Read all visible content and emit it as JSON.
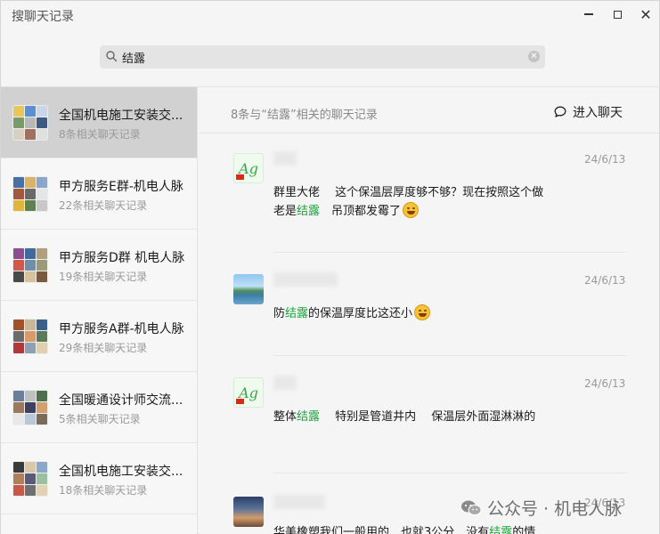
{
  "window": {
    "title": "搜聊天记录",
    "controls": [
      "minimize",
      "maximize",
      "close"
    ]
  },
  "search": {
    "value": "结露",
    "icon": "search-icon",
    "clear_icon": "clear-icon"
  },
  "sidebar": {
    "items": [
      {
        "name": "全国机电施工安装交...",
        "count": "8条相关聊天记录",
        "selected": true
      },
      {
        "name": "甲方服务E群-机电人脉",
        "count": "22条相关聊天记录",
        "selected": false
      },
      {
        "name": "甲方服务D群 机电人脉",
        "count": "19条相关聊天记录",
        "selected": false
      },
      {
        "name": "甲方服务A群-机电人脉",
        "count": "29条相关聊天记录",
        "selected": false
      },
      {
        "name": "全国暖通设计师交流...",
        "count": "5条相关聊天记录",
        "selected": false
      },
      {
        "name": "全国机电施工安装交...",
        "count": "18条相关聊天记录",
        "selected": false
      }
    ]
  },
  "main": {
    "summary": "8条与“结露”相关的聊天记录",
    "enter_chat": "进入聊天",
    "keyword_color": "#19a33a",
    "messages": [
      {
        "date": "24/6/13",
        "parts": [
          "群里大佬　 这个保温层厚度够不够？现在按照这个做　老是",
          "结露",
          "　吊顶都发霉了"
        ],
        "emoji": true
      },
      {
        "date": "24/6/13",
        "parts": [
          "防",
          "结露",
          "的保温厚度比这还小"
        ],
        "emoji": true
      },
      {
        "date": "24/6/13",
        "parts": [
          "整体",
          "结露",
          "　 特别是管道井内　 保温层外面湿淋淋的"
        ],
        "emoji": false
      },
      {
        "date": "24/6/13",
        "parts": [
          "华美橡塑我们一般用的　也就3公分　没有",
          "结露",
          "的情"
        ],
        "emoji": false
      }
    ]
  },
  "watermark": {
    "text": "公众号 · 机电人脉"
  }
}
